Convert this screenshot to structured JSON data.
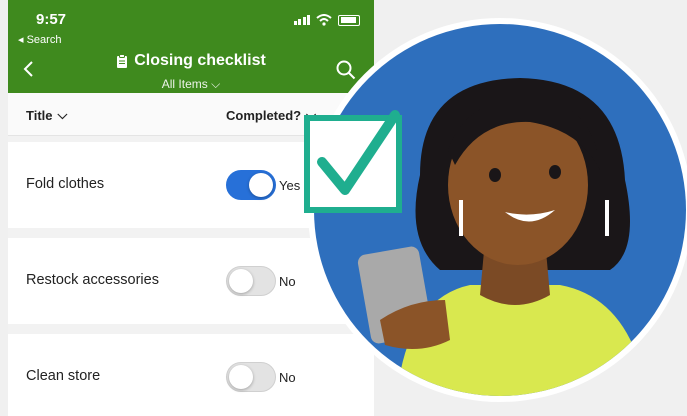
{
  "status_bar": {
    "time": "9:57",
    "back_label": "◂ Search"
  },
  "header": {
    "title": "Closing checklist",
    "view_label": "All Items",
    "view_caret": "⌵"
  },
  "columns": {
    "title": "Title",
    "completed": "Completed?",
    "caret": "⌵"
  },
  "items": [
    {
      "title": "Fold clothes",
      "completed": true,
      "value_label": "Yes"
    },
    {
      "title": "Restock accessories",
      "completed": false,
      "value_label": "No"
    },
    {
      "title": "Clean store",
      "completed": false,
      "value_label": "No"
    }
  ],
  "colors": {
    "header_green": "#3f8a1e",
    "toggle_on": "#2770d8",
    "circle_blue": "#2e6fbd",
    "check_teal": "#1fae8f"
  }
}
